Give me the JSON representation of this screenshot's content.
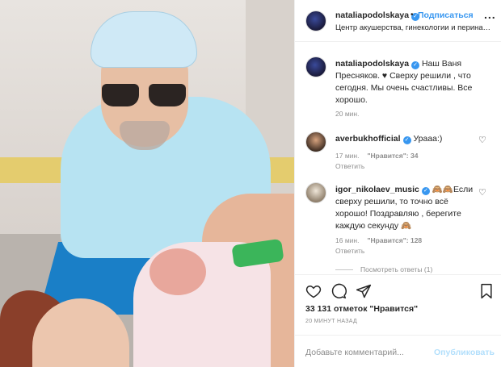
{
  "header": {
    "username": "nataliapodolskaya",
    "follow_label": "Подписаться",
    "separator": "•",
    "location": "Центр акушерства, гинекологии и перинатологии",
    "more": "..."
  },
  "caption": {
    "username": "nataliapodolskaya",
    "text": " Наш Ваня Пресняков. ♥ Сверху решили , что сегодня. Мы очень счастливы. Все хорошо.",
    "time": "20 мин."
  },
  "comments": [
    {
      "username": "averbukhofficial",
      "text": " Урааа:)",
      "time": "17 мин.",
      "likes": "\"Нравится\": 34",
      "reply": "Ответить"
    },
    {
      "username": "igor_nikolaev_music",
      "text": " 🙈🙈Если сверху решили, то точно всё хорошо! Поздравляю , берегите каждую секунду 🙈",
      "time": "16 мин.",
      "likes": "\"Нравится\": 128",
      "reply": "Ответить"
    }
  ],
  "view_replies": "Посмотреть ответы (1)",
  "likes_count": "33 131 отметок \"Нравится\"",
  "post_date": "20 МИНУТ НАЗАД",
  "composer": {
    "placeholder": "Добавьте комментарий...",
    "publish_label": "Опубликовать"
  },
  "icons": [
    "heart-icon",
    "comment-icon",
    "share-icon",
    "bookmark-icon",
    "verified-icon",
    "more-icon"
  ],
  "colors": {
    "accent": "#3897f0",
    "muted": "#8e8e8e",
    "publish_disabled": "#b2dffc"
  }
}
